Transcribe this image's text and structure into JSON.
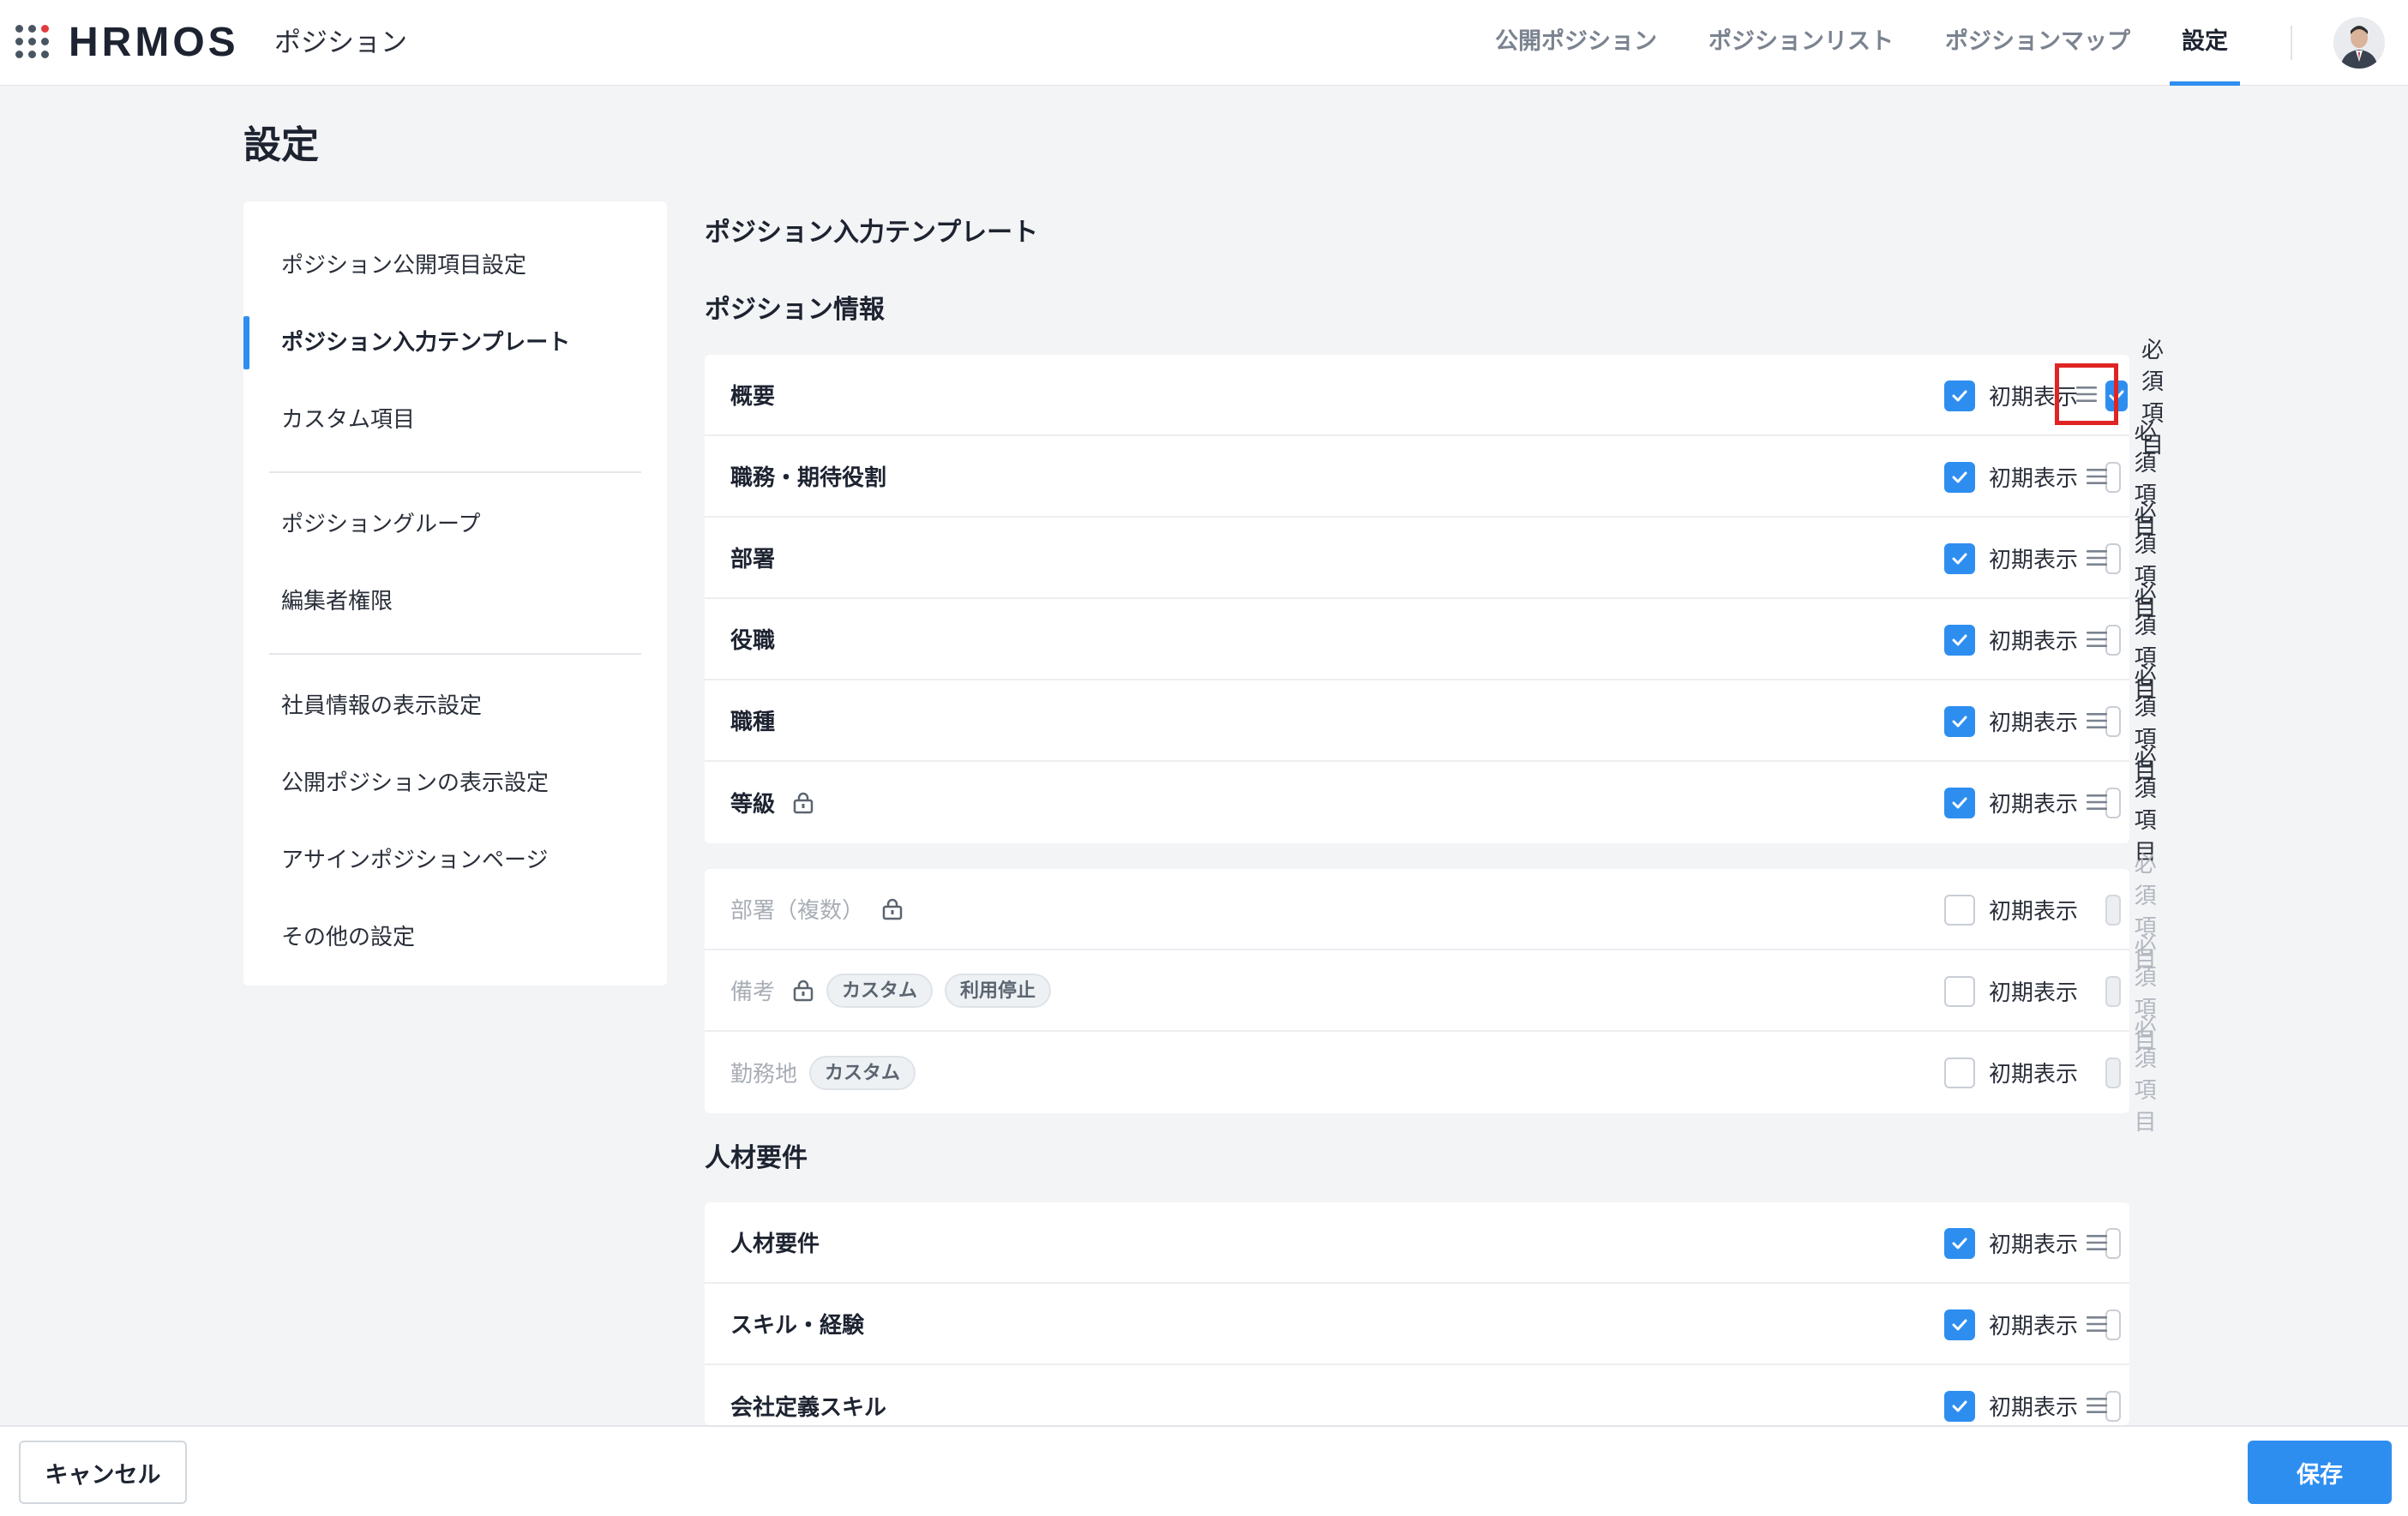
{
  "header": {
    "logo": "HRMOS",
    "product": "ポジション",
    "nav": [
      {
        "label": "公開ポジション",
        "active": false
      },
      {
        "label": "ポジションリスト",
        "active": false
      },
      {
        "label": "ポジションマップ",
        "active": false
      },
      {
        "label": "設定",
        "active": true
      }
    ]
  },
  "page": {
    "title": "設定"
  },
  "sidebar": {
    "groups": [
      [
        "ポジション公開項目設定",
        "ポジション入力テンプレート",
        "カスタム項目"
      ],
      [
        "ポジショングループ",
        "編集者権限"
      ],
      [
        "社員情報の表示設定",
        "公開ポジションの表示設定",
        "アサインポジションページ",
        "その他の設定"
      ]
    ],
    "active": "ポジション入力テンプレート"
  },
  "main": {
    "heading": "ポジション入力テンプレート",
    "initial_label": "初期表示",
    "required_label": "必須項目",
    "sections": [
      {
        "title": "ポジション情報",
        "rows": [
          {
            "label": "概要",
            "initial": true,
            "required": true,
            "lock": false,
            "tags": []
          },
          {
            "label": "職務・期待役割",
            "initial": true,
            "required": false,
            "lock": false,
            "tags": []
          },
          {
            "label": "部署",
            "initial": true,
            "required": false,
            "lock": false,
            "tags": []
          },
          {
            "label": "役職",
            "initial": true,
            "required": false,
            "lock": false,
            "tags": []
          },
          {
            "label": "職種",
            "initial": true,
            "required": false,
            "lock": false,
            "tags": []
          },
          {
            "label": "等級",
            "initial": true,
            "required": false,
            "lock": true,
            "tags": []
          }
        ],
        "disabled_rows": [
          {
            "label": "部署（複数）",
            "initial": false,
            "required": false,
            "lock": true,
            "tags": []
          },
          {
            "label": "備考",
            "initial": false,
            "required": false,
            "lock": true,
            "tags": [
              "カスタム",
              "利用停止"
            ]
          },
          {
            "label": "勤務地",
            "initial": false,
            "required": false,
            "lock": false,
            "tags": [
              "カスタム"
            ]
          }
        ]
      },
      {
        "title": "人材要件",
        "rows": [
          {
            "label": "人材要件",
            "initial": true,
            "required": false,
            "lock": false,
            "tags": []
          },
          {
            "label": "スキル・経験",
            "initial": true,
            "required": false,
            "lock": false,
            "tags": []
          },
          {
            "label": "会社定義スキル",
            "initial": true,
            "required": false,
            "lock": false,
            "tags": []
          }
        ]
      }
    ]
  },
  "footer": {
    "cancel": "キャンセル",
    "save": "保存"
  },
  "colors": {
    "accent": "#2e8ef0",
    "highlight": "#e02424"
  }
}
